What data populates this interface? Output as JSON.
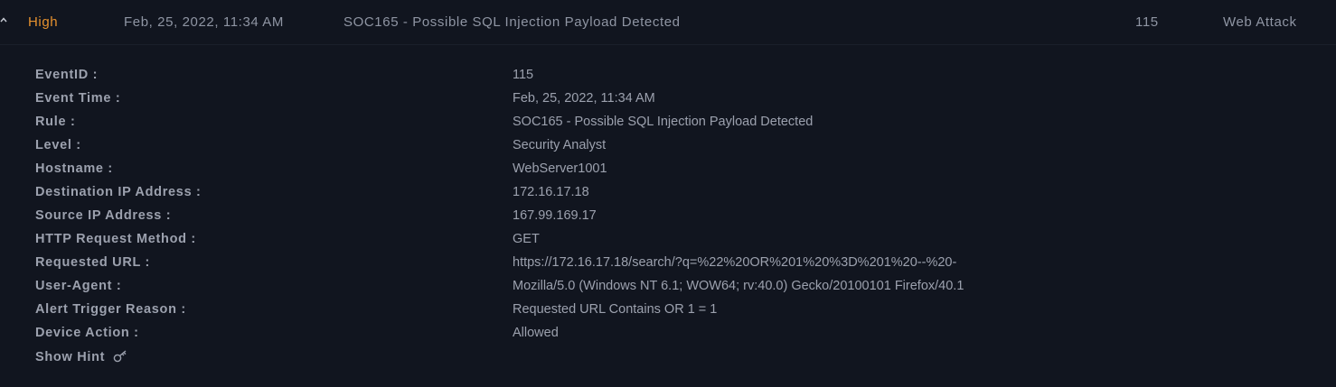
{
  "alert": {
    "level": "High",
    "date": "Feb, 25, 2022, 11:34 AM",
    "rule": "SOC165 - Possible SQL Injection Payload Detected",
    "event_id": "115",
    "type": "Web Attack",
    "level_color": "#e6912e"
  },
  "details": [
    {
      "label": "EventID :",
      "value": "115"
    },
    {
      "label": "Event Time :",
      "value": "Feb, 25, 2022, 11:34 AM"
    },
    {
      "label": "Rule :",
      "value": "SOC165 - Possible SQL Injection Payload Detected"
    },
    {
      "label": "Level :",
      "value": "Security Analyst"
    },
    {
      "label": "Hostname :",
      "value": "WebServer1001"
    },
    {
      "label": "Destination IP Address :",
      "value": "172.16.17.18"
    },
    {
      "label": "Source IP Address :",
      "value": "167.99.169.17"
    },
    {
      "label": "HTTP Request Method :",
      "value": "GET"
    },
    {
      "label": "Requested URL :",
      "value": "https://172.16.17.18/search/?q=%22%20OR%201%20%3D%201%20--%20-"
    },
    {
      "label": "User-Agent :",
      "value": "Mozilla/5.0 (Windows NT 6.1; WOW64; rv:40.0) Gecko/20100101 Firefox/40.1"
    },
    {
      "label": "Alert Trigger Reason :",
      "value": "Requested URL Contains OR 1 = 1"
    },
    {
      "label": "Device Action :",
      "value": "Allowed"
    }
  ],
  "hint": {
    "label": "Show Hint",
    "icon": "key-icon"
  }
}
